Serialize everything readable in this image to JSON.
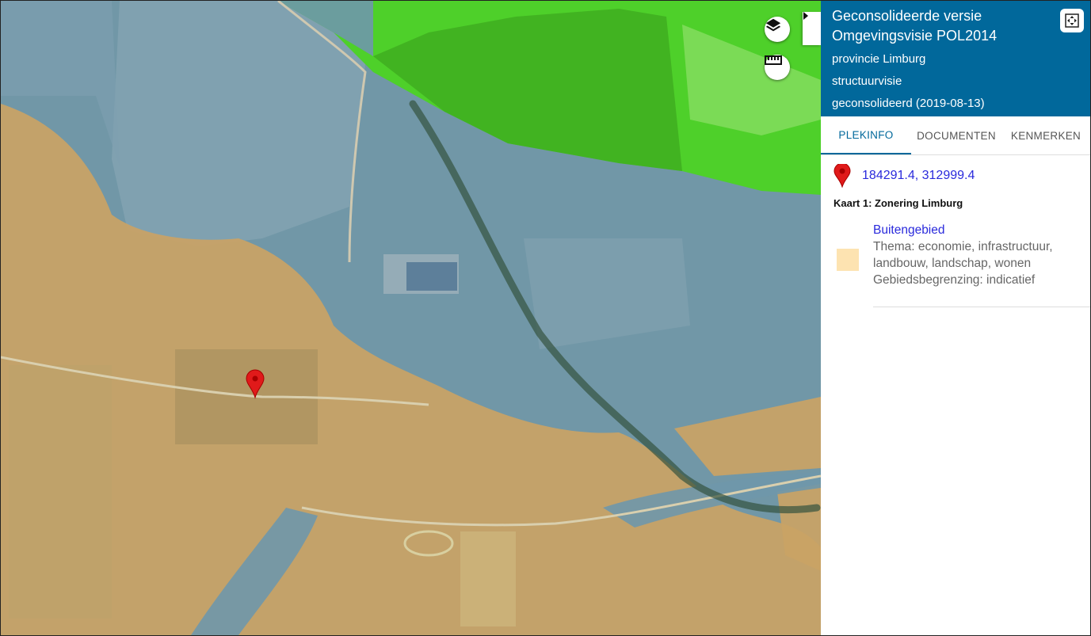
{
  "panel": {
    "title": "Geconsolideerde versie Omgevingsvisie POL2014",
    "organisation": "provincie Limburg",
    "plan_type": "structuurvisie",
    "status": "geconsolideerd (2019-08-13)"
  },
  "tabs": [
    {
      "label": "PLEKINFO",
      "active": true
    },
    {
      "label": "DOCUMENTEN",
      "active": false
    },
    {
      "label": "KENMERKEN",
      "active": false
    }
  ],
  "location": {
    "coordinates": "184291.4, 312999.4"
  },
  "map_info": {
    "kaart_label": "Kaart 1: Zonering Limburg",
    "legend": {
      "name": "Buitengebied",
      "description_lines": [
        "Thema: economie, infrastructuur,",
        "landbouw, landschap, wonen",
        "Gebiedsbegrenzing: indicatief"
      ],
      "swatch_color": "#fde3b1"
    }
  },
  "map": {
    "zone_colors": {
      "buitengebied": "#c9a365",
      "blue_zone": "#6f97ab",
      "green_zone": "#4ed02a"
    },
    "marker_color": "#e01a1a"
  },
  "icons": {
    "layers": "layers-icon",
    "measure": "ruler-icon",
    "collapse": "caret-right-icon",
    "fullscreen": "fullscreen-icon",
    "marker": "map-marker-icon"
  },
  "theme": {
    "header_bg": "#01689b",
    "link": "#2a2adc"
  }
}
